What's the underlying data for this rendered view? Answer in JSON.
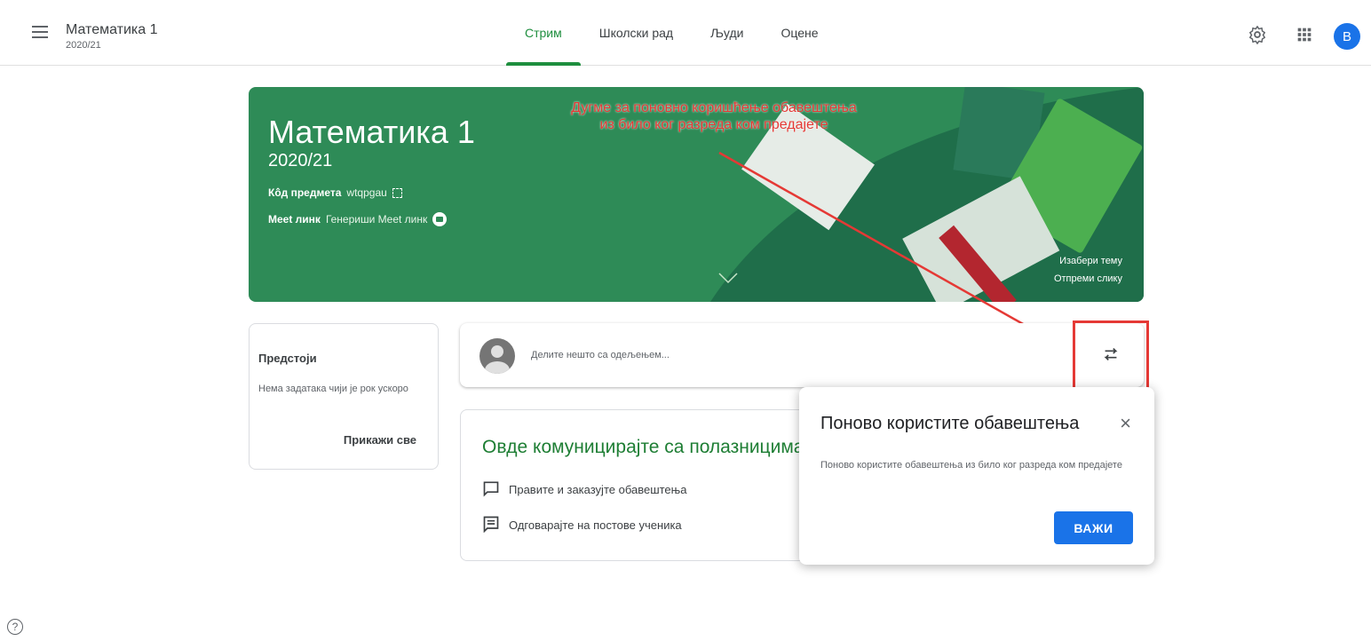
{
  "header": {
    "class_title": "Математика 1",
    "class_subtitle": "2020/21",
    "tabs": [
      {
        "label": "Стрим",
        "active": true
      },
      {
        "label": "Школски рад",
        "active": false
      },
      {
        "label": "Људи",
        "active": false
      },
      {
        "label": "Оцене",
        "active": false
      }
    ],
    "avatar_letter": "В",
    "icons": [
      "menu-icon",
      "settings-icon",
      "apps-grid-icon"
    ]
  },
  "banner": {
    "title": "Математика 1",
    "year": "2020/21",
    "code_label": "Кôд предмета",
    "code_value": "wtqpgau",
    "meet_label": "Meet линк",
    "meet_value": "Генериши Meet линк",
    "choose_theme": "Изабери тему",
    "upload_photo": "Отпреми слику",
    "color": "#2e8b57"
  },
  "annotation": {
    "line1": "Дугме за поновно коришћење обавештења",
    "line2": "из било ког разреда ком предајете",
    "color": "#e53935"
  },
  "upcoming": {
    "title": "Предстоји",
    "text": "Нема задатака чији је рок ускоро",
    "view_all": "Прикажи све"
  },
  "share": {
    "placeholder": "Делите нешто са одељењем..."
  },
  "communicate": {
    "title": "Овде комуницирајте са полазницима",
    "items": [
      "Правите и заказујте обавештења",
      "Одговарајте на постове ученика"
    ]
  },
  "popup": {
    "title": "Поново користите обавештења",
    "text": "Поново користите обавештења из било ког разреда ком предајете",
    "ok_label": "ВАЖИ",
    "close_glyph": "×"
  },
  "help_glyph": "?"
}
